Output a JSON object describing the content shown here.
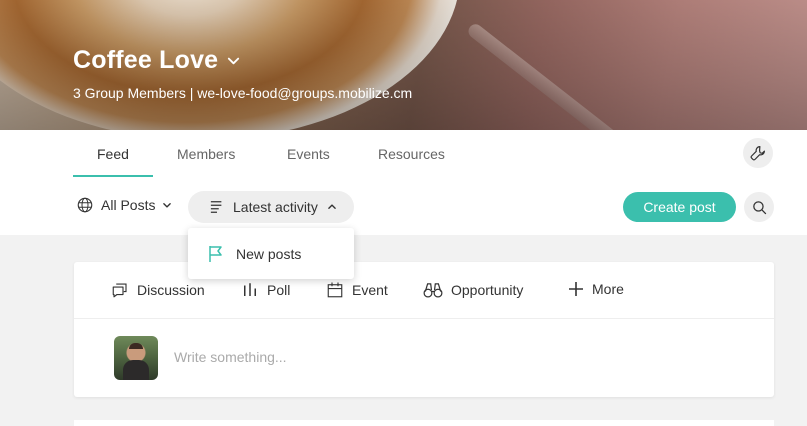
{
  "group": {
    "name": "Coffee Love",
    "subtitle": "3 Group Members | we-love-food@groups.mobilize.cm"
  },
  "tabs": [
    {
      "label": "Feed",
      "active": true
    },
    {
      "label": "Members",
      "active": false
    },
    {
      "label": "Events",
      "active": false
    },
    {
      "label": "Resources",
      "active": false
    }
  ],
  "filters": {
    "all_posts_label": "All Posts",
    "sort_label": "Latest activity",
    "sort_options": [
      {
        "label": "New posts",
        "icon": "flag-icon"
      }
    ]
  },
  "actions": {
    "create_post_label": "Create post",
    "settings_icon": "wrench-icon",
    "search_icon": "search-icon"
  },
  "composer": {
    "post_types": [
      {
        "label": "Discussion",
        "icon": "discussion-icon"
      },
      {
        "label": "Poll",
        "icon": "poll-icon"
      },
      {
        "label": "Event",
        "icon": "calendar-icon"
      },
      {
        "label": "Opportunity",
        "icon": "binoculars-icon"
      },
      {
        "label": "More",
        "icon": "plus-icon"
      }
    ],
    "placeholder": "Write something..."
  },
  "colors": {
    "accent": "#3bbfad"
  }
}
